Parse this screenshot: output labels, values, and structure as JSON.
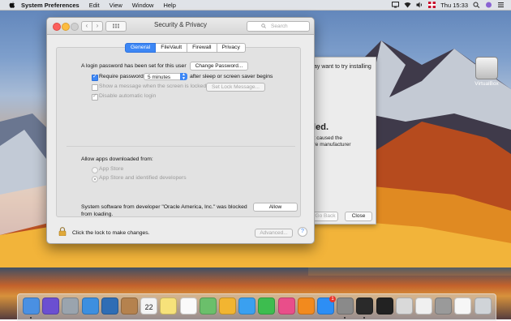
{
  "menubar": {
    "app_name": "System Preferences",
    "menus": [
      "Edit",
      "View",
      "Window",
      "Help"
    ],
    "clock": "Thu 15:33"
  },
  "window": {
    "title": "Security & Privacy",
    "search_placeholder": "Search",
    "tabs": [
      {
        "label": "General",
        "active": true
      },
      {
        "label": "FileVault",
        "active": false
      },
      {
        "label": "Firewall",
        "active": false
      },
      {
        "label": "Privacy",
        "active": false
      }
    ],
    "general": {
      "login_password_text": "A login password has been set for this user",
      "change_password_button": "Change Password...",
      "require_password_label": "Require password",
      "require_password_checked": true,
      "require_password_delay": "5 minutes",
      "after_sleep_text": "after sleep or screen saver begins",
      "show_message_label": "Show a message when the screen is locked",
      "set_lock_message_button": "Set Lock Message...",
      "disable_auto_login_label": "Disable automatic login",
      "allow_apps_label": "Allow apps downloaded from:",
      "radio_app_store": "App Store",
      "radio_identified": "App Store and identified developers",
      "blocked_text_line1": "System software from developer \"Oracle America, Inc.\" was blocked",
      "blocked_text_line2": "from loading.",
      "allow_button": "Allow"
    },
    "footer": {
      "lock_text": "Click the lock to make changes.",
      "advanced_button": "Advanced...",
      "help_button": "?"
    }
  },
  "background_dialog": {
    "partial_text_top": "ay want to try installing",
    "partial_heading": "iled.",
    "partial_body": [
      "at caused the",
      "are manufacturer"
    ],
    "go_back_button": "Go Back",
    "close_button": "Close"
  },
  "desktop_icon": {
    "label": "VirtualBox"
  },
  "dock": {
    "apps": [
      {
        "name": "finder",
        "color": "#4a90e2"
      },
      {
        "name": "siri",
        "color": "#6b4fd1"
      },
      {
        "name": "launchpad",
        "color": "#9aa4ae"
      },
      {
        "name": "safari",
        "color": "#3d8fe0"
      },
      {
        "name": "photo-browser",
        "color": "#2f6db5"
      },
      {
        "name": "contacts",
        "color": "#b5824e"
      },
      {
        "name": "calendar",
        "color": "#f4f4f4"
      },
      {
        "name": "notes",
        "color": "#f7e27a"
      },
      {
        "name": "reminders",
        "color": "#fafafa"
      },
      {
        "name": "maps",
        "color": "#6bbf6b"
      },
      {
        "name": "photos",
        "color": "#f2b531"
      },
      {
        "name": "messages",
        "color": "#3aa0f0"
      },
      {
        "name": "facetime",
        "color": "#3dbd4f"
      },
      {
        "name": "itunes",
        "color": "#e94e8a"
      },
      {
        "name": "ibooks",
        "color": "#f28a1e"
      },
      {
        "name": "app-store",
        "color": "#2d8ef5"
      },
      {
        "name": "system-preferences",
        "color": "#8a8a8a"
      },
      {
        "name": "terminal",
        "color": "#2a2a2a"
      },
      {
        "name": "activity-monitor",
        "color": "#222"
      },
      {
        "name": "script-editor",
        "color": "#d9d9d9"
      },
      {
        "name": "textedit",
        "color": "#f0f0f0"
      },
      {
        "name": "disk-utility",
        "color": "#9a9a9a"
      },
      {
        "name": "document",
        "color": "#f6f6f6"
      },
      {
        "name": "trash",
        "color": "#d0d4d8"
      }
    ],
    "calendar_day": "22",
    "app_store_badge": "1"
  }
}
